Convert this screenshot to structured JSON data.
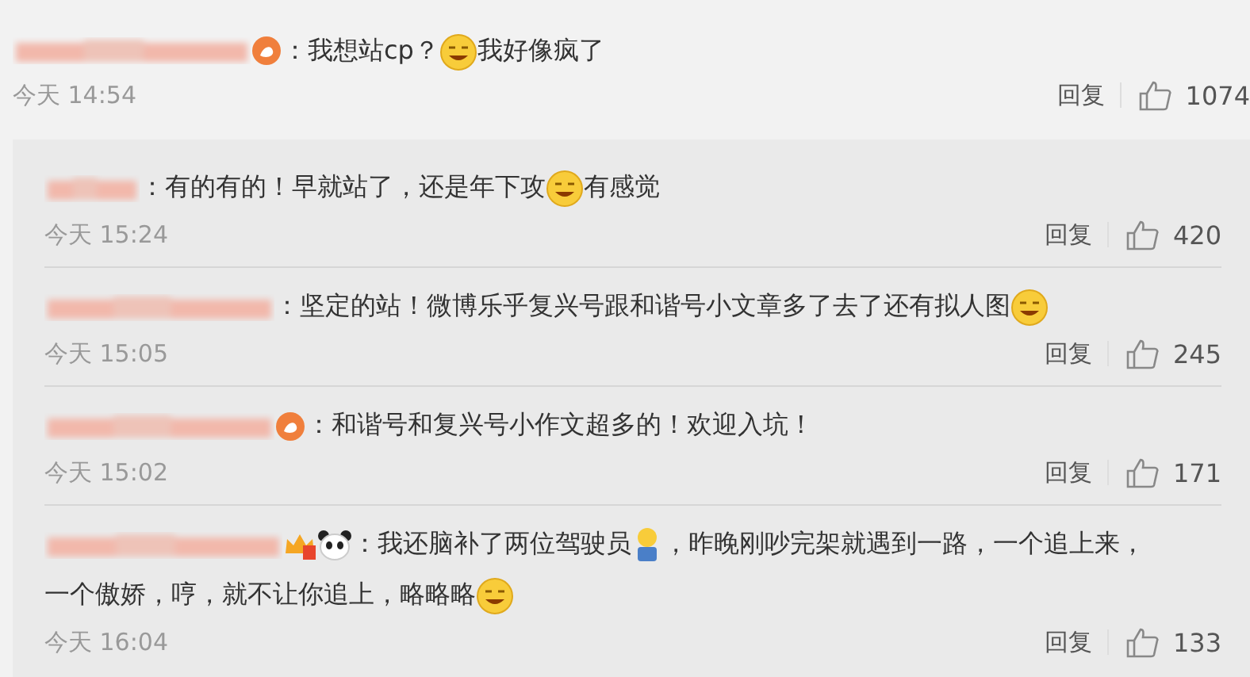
{
  "comment": {
    "badges": [
      {
        "kind": "member"
      }
    ],
    "body": [
      {
        "kind": "text",
        "text": "：我想站cp？"
      },
      {
        "kind": "emoji"
      },
      {
        "kind": "text",
        "text": "我好像疯了"
      }
    ],
    "time": "今天 14:54",
    "reply_label": "回复",
    "likes": "1074"
  },
  "replies": [
    {
      "body": [
        {
          "kind": "text",
          "text": "：有的有的！早就站了，还是年下攻"
        },
        {
          "kind": "emoji"
        },
        {
          "kind": "text",
          "text": "有感觉"
        }
      ],
      "time": "今天 15:24",
      "reply_label": "回复",
      "likes": "420"
    },
    {
      "body": [
        {
          "kind": "text",
          "text": "：坚定的站！微博乐乎复兴号跟和谐号小文章多了去了还有拟人图"
        },
        {
          "kind": "emoji"
        }
      ],
      "time": "今天 15:05",
      "reply_label": "回复",
      "likes": "245"
    },
    {
      "badges": [
        {
          "kind": "member"
        }
      ],
      "body": [
        {
          "kind": "text",
          "text": "：和谐号和复兴号小作文超多的！欢迎入坑！"
        }
      ],
      "time": "今天 15:02",
      "reply_label": "回复",
      "likes": "171"
    },
    {
      "badges": [
        {
          "kind": "crown"
        },
        {
          "kind": "panda"
        }
      ],
      "body": [
        {
          "kind": "text",
          "text": "：我还脑补了两位驾驶员"
        },
        {
          "kind": "figure"
        },
        {
          "kind": "text",
          "text": "，昨晚刚吵完架就遇到一路，一个追上来，"
        }
      ],
      "body_continued": [
        {
          "kind": "text",
          "text": "一个傲娇，哼，就不让你追上，略略略"
        },
        {
          "kind": "emoji"
        }
      ],
      "time": "今天 16:04",
      "reply_label": "回复",
      "likes": "133"
    }
  ]
}
